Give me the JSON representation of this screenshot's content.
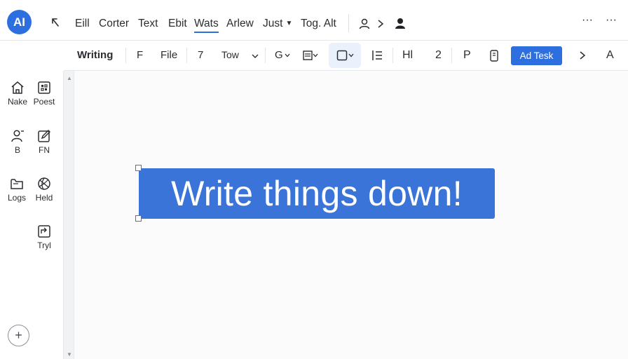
{
  "app": {
    "logo_text": "AI",
    "accent_color": "#2e6fe0"
  },
  "menubar": {
    "back_icon": "arrow-turn-left-icon",
    "items": [
      {
        "label": "Eill"
      },
      {
        "label": "Corter"
      },
      {
        "label": "Text"
      },
      {
        "label": "Ebit"
      },
      {
        "label": "Wats",
        "active": true
      },
      {
        "label": "Arlew"
      },
      {
        "label": "Just",
        "has_dropdown": true
      },
      {
        "label": "Tog. Alt"
      }
    ],
    "right_icons": [
      "user-outline-icon",
      "chevron-right-icon",
      "user-filled-icon"
    ],
    "more_label": "···"
  },
  "toolbar": {
    "items": [
      {
        "label": "Writing"
      },
      {
        "label": "F"
      },
      {
        "label": "File"
      },
      {
        "label": "7"
      },
      {
        "label": "Tow"
      },
      {
        "label": "G"
      },
      {
        "label": "Hl"
      },
      {
        "label": "2"
      },
      {
        "label": "P"
      },
      {
        "label": "A"
      }
    ],
    "add_text_button": "Ad Tesk",
    "icons": [
      "chevron-down-icon",
      "paragraph-style-icon",
      "box-select-icon",
      "list-icon",
      "mobile-icon",
      "chevron-right-icon"
    ]
  },
  "sidebar": {
    "items": [
      {
        "label": "Nake",
        "icon": "home-icon"
      },
      {
        "label": "Poest",
        "icon": "grid-square-icon"
      },
      {
        "label": "B",
        "icon": "user-add-icon"
      },
      {
        "label": "FN",
        "icon": "edit-square-icon"
      },
      {
        "label": "Logs",
        "icon": "folder-icon"
      },
      {
        "label": "Held",
        "icon": "globe-icon"
      },
      {
        "label": "Tryl",
        "icon": "export-box-icon"
      }
    ],
    "add_label": "+"
  },
  "canvas": {
    "text_box": "Write things down!",
    "text_box_color": "#3a74d8"
  }
}
